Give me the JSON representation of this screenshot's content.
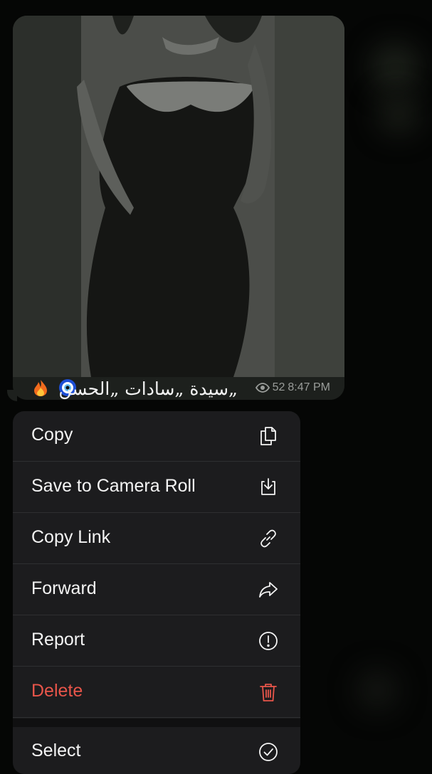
{
  "message": {
    "caption": "„سيدة „سادات „الحسن",
    "views": "52",
    "time": "8:47 PM",
    "emojis": [
      "fire-emoji",
      "nazar-amulet-emoji"
    ]
  },
  "menu": {
    "items": [
      {
        "label": "Copy",
        "icon": "copy-icon"
      },
      {
        "label": "Save to Camera Roll",
        "icon": "download-icon"
      },
      {
        "label": "Copy Link",
        "icon": "link-icon"
      },
      {
        "label": "Forward",
        "icon": "forward-arrow-icon"
      },
      {
        "label": "Report",
        "icon": "report-exclamation-icon"
      },
      {
        "label": "Delete",
        "icon": "trash-icon"
      }
    ],
    "select": {
      "label": "Select",
      "icon": "checkmark-circle-icon"
    }
  },
  "colors": {
    "background": "#050605",
    "menu_bg": "#1c1c1e",
    "danger": "#e8554a",
    "text": "#f4f4f4",
    "meta": "#9a9d9a"
  }
}
